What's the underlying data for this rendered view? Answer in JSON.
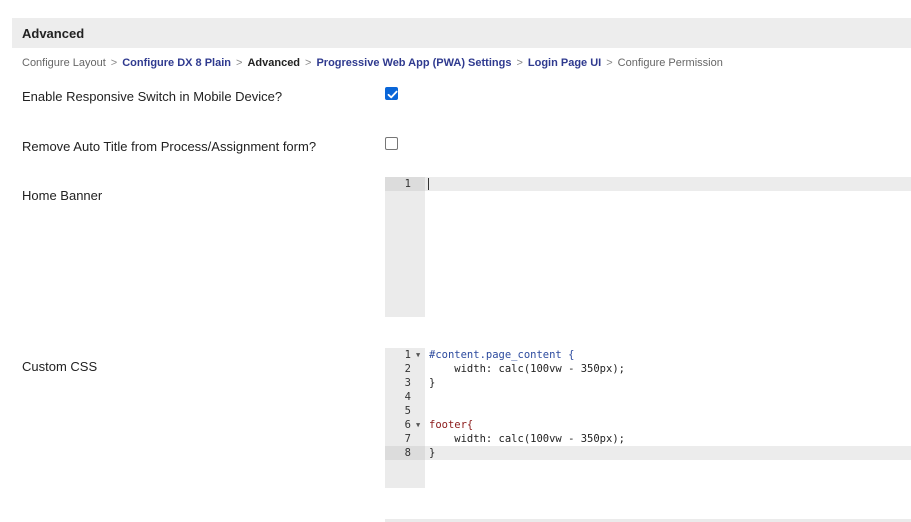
{
  "section": {
    "title": "Advanced"
  },
  "breadcrumb": [
    {
      "label": "Configure Layout",
      "kind": "plain"
    },
    {
      "label": "Configure DX 8 Plain",
      "kind": "link"
    },
    {
      "label": "Advanced",
      "kind": "current"
    },
    {
      "label": "Progressive Web App (PWA) Settings",
      "kind": "link"
    },
    {
      "label": "Login Page UI",
      "kind": "link"
    },
    {
      "label": "Configure Permission",
      "kind": "plain"
    }
  ],
  "breadcrumb_separator": ">",
  "fields": {
    "responsive_switch": {
      "label": "Enable Responsive Switch in Mobile Device?",
      "checked": true
    },
    "remove_auto_title": {
      "label": "Remove Auto Title from Process/Assignment form?",
      "checked": false
    },
    "home_banner": {
      "label": "Home Banner",
      "line_numbers": [
        "1"
      ]
    },
    "custom_css": {
      "label": "Custom CSS",
      "line_numbers": [
        "1",
        "2",
        "3",
        "4",
        "5",
        "6",
        "7",
        "8"
      ],
      "lines": [
        "#content.page_content {",
        "    width: calc(100vw - 350px);",
        "}",
        "",
        "",
        "footer{",
        "    width: calc(100vw - 350px);",
        "}"
      ],
      "active_line": 8,
      "fold_lines": [
        1,
        6
      ]
    }
  },
  "colors": {
    "header_bg": "#ededed",
    "link": "#2f3a8f",
    "checkbox_checked": "#0a66d8",
    "gutter_bg": "#ebebeb"
  }
}
